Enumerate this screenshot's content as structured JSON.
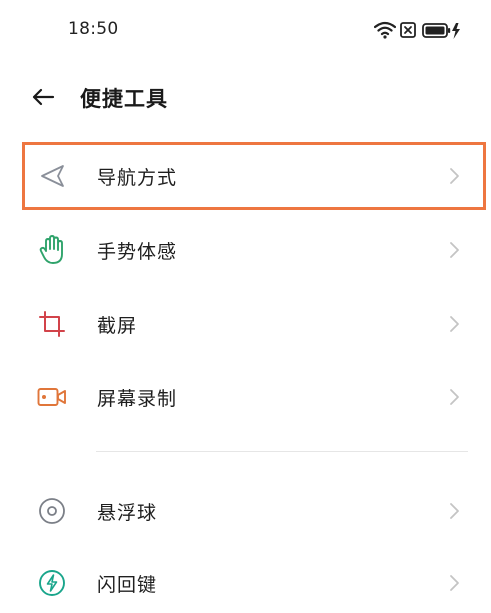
{
  "status_bar": {
    "time": "18:50",
    "icons": [
      "wifi-icon",
      "sim-icon",
      "battery-charging-icon"
    ]
  },
  "header": {
    "back_icon": "arrow-left-icon",
    "title": "便捷工具"
  },
  "items": [
    {
      "label": "导航方式",
      "icon": "navigation-arrow-icon",
      "icon_color": "#8a8f99",
      "highlighted": true
    },
    {
      "label": "手势体感",
      "icon": "hand-gesture-icon",
      "icon_color": "#2fa36b"
    },
    {
      "label": "截屏",
      "icon": "crop-screenshot-icon",
      "icon_color": "#d2434a"
    },
    {
      "label": "屏幕录制",
      "icon": "screen-record-icon",
      "icon_color": "#e0763a"
    },
    {
      "label": "悬浮球",
      "icon": "floating-ball-icon",
      "icon_color": "#7b7f87"
    },
    {
      "label": "闪回键",
      "icon": "flashback-key-icon",
      "icon_color": "#19a58b"
    }
  ],
  "colors": {
    "highlight_border": "#ee7640",
    "chevron": "#c4c4c4",
    "divider": "#e6e6e6"
  }
}
